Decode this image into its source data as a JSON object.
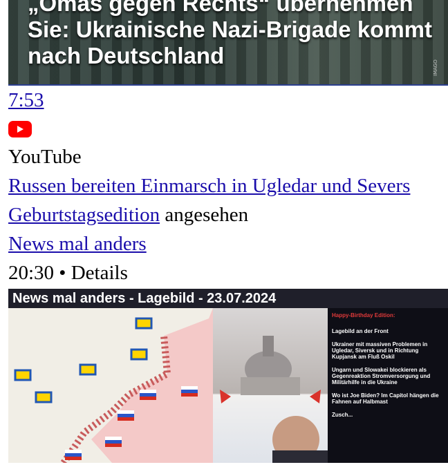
{
  "top_video": {
    "headline": "„Omas gegen Rechts“ übernehmen Sie: Ukrainische Nazi-Brigade kommt nach Deutschland",
    "duration": "7:53",
    "platform_icon": "youtube-icon",
    "source": "YouTube",
    "colors": {
      "youtube_red": "#ff0000",
      "link": "#1a0dab",
      "accent_border": "#2c3f8f"
    }
  },
  "history": {
    "title_link": "Russen bereiten Einmarsch in Ugledar und Severs",
    "channel_link": "Geburtstagsedition",
    "action": "angesehen"
  },
  "next_item": {
    "link": "News mal anders",
    "meta": "20:30 • Details",
    "thumb_title": "News mal anders - Lagebild - 23.07.2024",
    "side_header": "Happy-Birthday Edition:",
    "side_points": [
      "Lagebild an der Front",
      "Ukrainer mit massiven Problemen in Ugledar, Siversk und in Richtung Kupjansk am Fluß Oskil",
      "Ungarn und Slowakei blockieren als Gegenreaktion Stromversorgung und Militärhilfe in die Ukraine",
      "Wo ist Joe Biden? Im Capitol hängen die Fahnen auf Halbmast",
      "Zusch..."
    ]
  }
}
